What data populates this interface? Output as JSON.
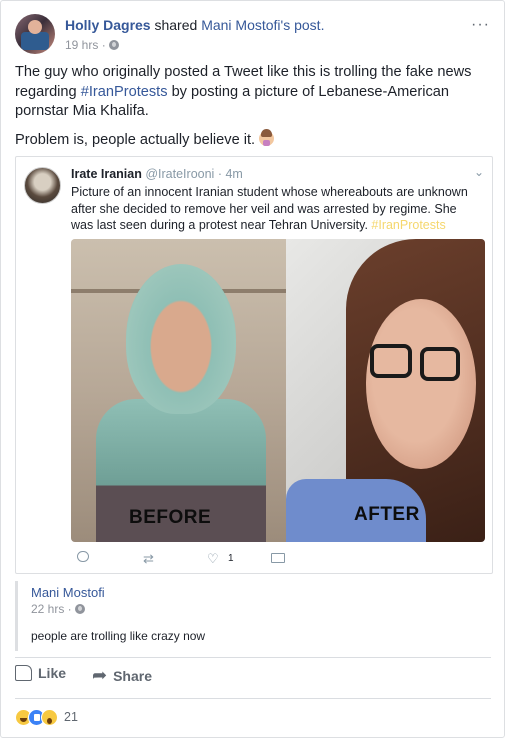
{
  "post": {
    "author": "Holly Dagres",
    "shared_verb": "shared",
    "shared_from": "Mani Mostofi's",
    "shared_object": "post.",
    "time": "19 hrs",
    "time_sep": "·",
    "more": "···",
    "text_part1": "The guy who originally posted a Tweet like this is trolling the fake news regarding ",
    "text_hashtag": "#IranProtests",
    "text_part2": " by posting a picture of Lebanese-American pornstar Mia Khalifa.",
    "text_line2": "Problem is, people actually believe it."
  },
  "tweet": {
    "name": "Irate Iranian",
    "handle": "@IrateIrooni",
    "time": "· 4m",
    "chevron": "⌄",
    "text": "Picture of an innocent Iranian student whose whereabouts are unknown after she decided to remove her veil and was arrested by regime. She was last seen during a protest near Tehran University. ",
    "hashtag": "#IranProtests",
    "caption_before": "BEFORE",
    "caption_after": "AFTER",
    "retweet_icon": "⇄",
    "like_icon": "♡",
    "like_count": "1"
  },
  "shared_post": {
    "name": "Mani Mostofi",
    "time": "22 hrs ·",
    "comment": "people are trolling like crazy now"
  },
  "actions": {
    "like_label": "Like",
    "share_label": "Share",
    "share_icon": "➦"
  },
  "reactions": {
    "count": "21"
  },
  "colors": {
    "link": "#365899",
    "muted": "#90949c",
    "hashtag_tweet": "#f5d76e"
  }
}
